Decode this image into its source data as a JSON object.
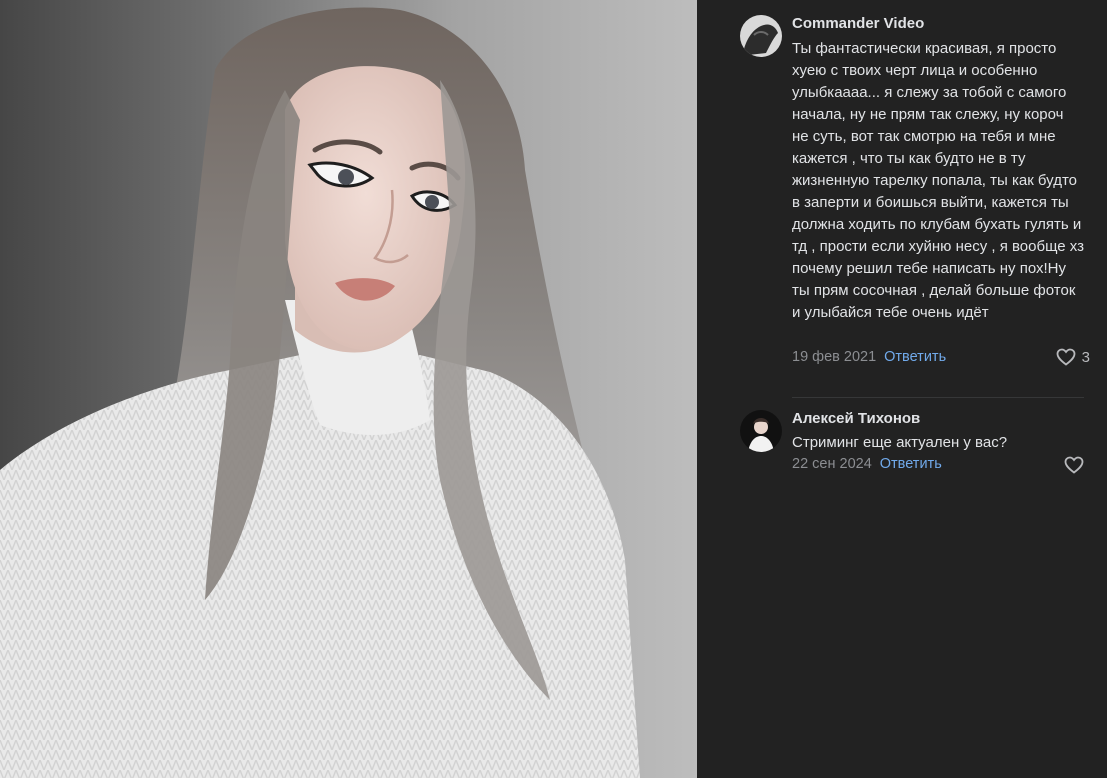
{
  "photo": {
    "icon": "portrait-photo"
  },
  "comments": [
    {
      "author": "Commander Video",
      "text": "Ты фантастически красивая, я просто хуею с твоих черт лица и особенно улыбкаааа... я слежу за тобой с самого начала, ну не прям так слежу, ну короч не суть, вот так смотрю на тебя и мне кажется , что ты как будто не в ту жизненную тарелку попала, ты как будто в заперти и боишься выйти, кажется ты должна ходить по клубам бухать гулять и тд , прости если хуйню несу , я вообще хз почему решил тебе написать ну пох!Ну ты прям сосочная , делай больше фоток и улыбайся тебе очень идёт",
      "date": "19 фев 2021",
      "reply_label": "Ответить",
      "likes": "3"
    },
    {
      "author": "Алексей Тихонов",
      "text": "Стриминг еще актуален у вас?",
      "date": "22 сен 2024",
      "reply_label": "Ответить",
      "likes": ""
    }
  ],
  "colors": {
    "panel_bg": "#222222",
    "text": "#e1e3e6",
    "secondary": "#8c8e92",
    "link": "#71aaeb"
  }
}
